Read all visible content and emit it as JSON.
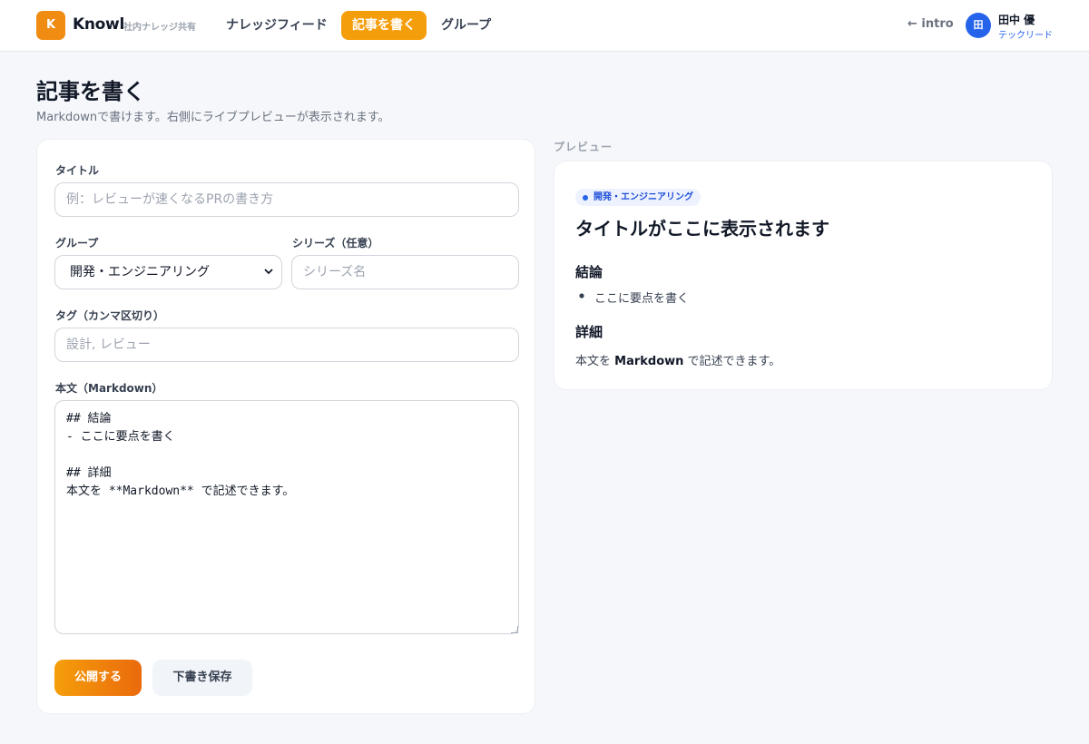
{
  "header": {
    "logo_letter": "K",
    "brand": "Knowl",
    "brand_sub": "社内ナレッジ共有",
    "nav": {
      "feed": "ナレッジフィード",
      "write": "記事を書く",
      "group": "グループ"
    },
    "intro_link": "← intro",
    "user": {
      "avatar_initial": "田",
      "name": "田中 優",
      "role": "テックリード"
    }
  },
  "page": {
    "title": "記事を書く",
    "subtitle": "Markdownで書けます。右側にライブプレビューが表示されます。"
  },
  "form": {
    "title_label": "タイトル",
    "title_placeholder": "例：レビューが速くなるPRの書き方",
    "group_label": "グループ",
    "group_selected": "開発・エンジニアリング",
    "series_label": "シリーズ（任意）",
    "series_placeholder": "シリーズ名",
    "tags_label": "タグ（カンマ区切り）",
    "tags_placeholder": "設計, レビュー",
    "body_label": "本文（Markdown）",
    "body_value": "## 結論\n- ここに要点を書く\n\n## 詳細\n本文を **Markdown** で記述できます。",
    "publish_button": "公開する",
    "draft_button": "下書き保存"
  },
  "preview": {
    "label": "プレビュー",
    "badge": "開発・エンジニアリング",
    "title": "タイトルがここに表示されます",
    "h2_conclusion": "結論",
    "bullet": "ここに要点を書く",
    "h2_detail": "詳細",
    "body_prefix": "本文を ",
    "body_bold": "Markdown",
    "body_suffix": " で記述できます。"
  },
  "colors": {
    "accent": "#f59e0b",
    "primary_blue": "#2563eb",
    "background": "#f5f7fa"
  }
}
